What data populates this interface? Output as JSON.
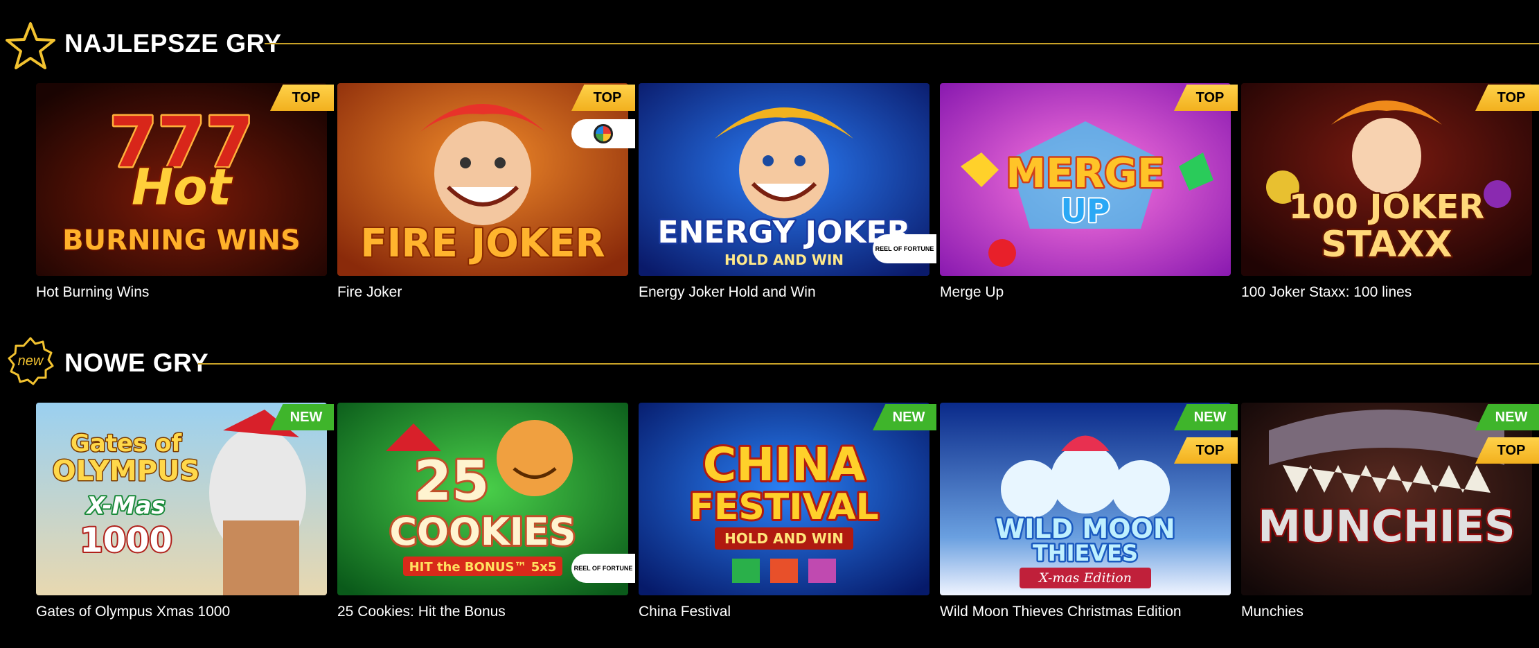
{
  "sections": [
    {
      "title": "NAJLEPSZE GRY",
      "icon": "star-icon",
      "games": [
        {
          "name": "Hot Burning Wins",
          "badges": [
            "TOP"
          ],
          "provider": null,
          "art_lines": [
            "777",
            "Hot",
            "BURNING WINS"
          ]
        },
        {
          "name": "Fire Joker",
          "badges": [
            "TOP"
          ],
          "provider": "wheel",
          "art_lines": [
            "FIRE JOKER"
          ]
        },
        {
          "name": "Energy Joker Hold and Win",
          "badges": [],
          "provider": "REEL OF FORTUNE",
          "art_lines": [
            "ENERGY JOKER",
            "HOLD AND WIN"
          ]
        },
        {
          "name": "Merge Up",
          "badges": [
            "TOP"
          ],
          "provider": null,
          "art_lines": [
            "MERGE",
            "UP"
          ]
        },
        {
          "name": "100 Joker Staxx: 100 lines",
          "badges": [
            "TOP"
          ],
          "provider": null,
          "art_lines": [
            "100 JOKER",
            "STAXX"
          ]
        }
      ]
    },
    {
      "title": "NOWE GRY",
      "icon": "new-badge-icon",
      "icon_text": "new",
      "games": [
        {
          "name": "Gates of Olympus Xmas 1000",
          "badges": [
            "NEW"
          ],
          "provider": null,
          "art_lines": [
            "Gates of",
            "OLYMPUS",
            "X-Mas",
            "1000"
          ]
        },
        {
          "name": "25 Cookies: Hit the Bonus",
          "badges": [],
          "provider": "REEL OF FORTUNE",
          "art_lines": [
            "25",
            "COOKIES",
            "HIT the BONUS™ 5x5"
          ]
        },
        {
          "name": "China Festival",
          "badges": [
            "NEW"
          ],
          "provider": null,
          "art_lines": [
            "CHINA",
            "FESTIVAL",
            "HOLD AND WIN"
          ]
        },
        {
          "name": "Wild Moon Thieves Christmas Edition",
          "badges": [
            "NEW",
            "TOP"
          ],
          "provider": null,
          "art_lines": [
            "WILD MOON",
            "THIEVES",
            "X-mas Edition"
          ]
        },
        {
          "name": "Munchies",
          "badges": [
            "NEW",
            "TOP"
          ],
          "provider": null,
          "art_lines": [
            "MUNCHIES"
          ]
        }
      ]
    }
  ],
  "colors": {
    "background": "#000000",
    "accent_line": "#c9a227",
    "top_badge": "#f5b622",
    "new_badge": "#3fb52b"
  }
}
